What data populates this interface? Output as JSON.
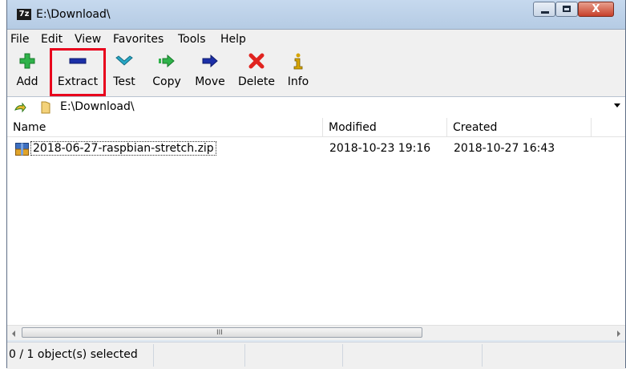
{
  "window": {
    "title": "E:\\Download\\",
    "app_icon_label": "7z",
    "close_label": "X"
  },
  "menu": [
    "File",
    "Edit",
    "View",
    "Favorites",
    "Tools",
    "Help"
  ],
  "toolbar": [
    {
      "label": "Add",
      "icon": "plus-icon",
      "color": "#2fb24a"
    },
    {
      "label": "Extract",
      "icon": "minus-icon",
      "color": "#1c2fa8"
    },
    {
      "label": "Test",
      "icon": "check-icon",
      "color": "#27a8c6"
    },
    {
      "label": "Copy",
      "icon": "copy-arrow-icon",
      "color": "#2fb24a"
    },
    {
      "label": "Move",
      "icon": "move-arrow-icon",
      "color": "#1c2fa8"
    },
    {
      "label": "Delete",
      "icon": "delete-x-icon",
      "color": "#e0231f"
    },
    {
      "label": "Info",
      "icon": "info-icon",
      "color": "#d6a400"
    }
  ],
  "address": {
    "path": "E:\\Download\\"
  },
  "columns": [
    "Name",
    "Modified",
    "Created"
  ],
  "files": [
    {
      "name": "2018-06-27-raspbian-stretch.zip",
      "modified": "2018-10-23 19:16",
      "created": "2018-10-27 16:43"
    }
  ],
  "scrollbar": {
    "grip": "III"
  },
  "status": {
    "text": "0 / 1 object(s) selected"
  }
}
